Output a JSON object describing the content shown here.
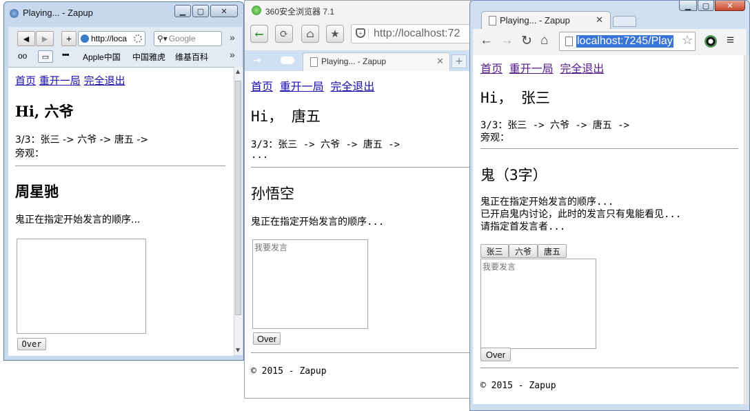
{
  "w1": {
    "title": "Playing... - Zapup",
    "address": "http://loca",
    "search_placeholder": "Google",
    "bookmarks": [
      "Apple中国",
      "中国雅虎",
      "维基百科"
    ],
    "nav": [
      "首页",
      "重开一局",
      "完全退出"
    ],
    "greeting": "Hi, 六爷",
    "order_line": "3/3：张三 -> 六爷 -> 唐五 ->",
    "watch_label": "旁观：",
    "role_name": "周星驰",
    "status": "鬼正在指定开始发言的顺序...",
    "textarea_placeholder": "",
    "over_button": "Over"
  },
  "w2": {
    "title": "360安全浏览器 7.1",
    "address": "http://localhost:72",
    "tab_title": "Playing... - Zapup",
    "nav": [
      "首页",
      "重开一局",
      "完全退出"
    ],
    "greeting": "Hi， 唐五",
    "order_line": "3/3：张三 -> 六爷 -> 唐五 ->",
    "ellipsis": "...",
    "role_name": "孙悟空",
    "status": "鬼正在指定开始发言的顺序...",
    "textarea_placeholder": "我要发言",
    "over_button": "Over",
    "footer": "© 2015 - Zapup"
  },
  "w3": {
    "tab_title": "Playing... - Zapup",
    "address": "localhost:7245/Play",
    "nav": [
      "首页",
      "重开一局",
      "完全退出"
    ],
    "greeting": "Hi， 张三",
    "order_line": "3/3：张三 -> 六爷 -> 唐五 ->",
    "watch_label": "旁观：",
    "role_heading": "鬼（3字）",
    "status_lines": [
      "鬼正在指定开始发言的顺序...",
      "已开启鬼内讨论，此时的发言只有鬼能看见...",
      "请指定首发言者..."
    ],
    "speaker_buttons": [
      "张三",
      "六爷",
      "唐五"
    ],
    "textarea_placeholder": "我要发言",
    "over_button": "Over",
    "footer": "© 2015 - Zapup"
  }
}
